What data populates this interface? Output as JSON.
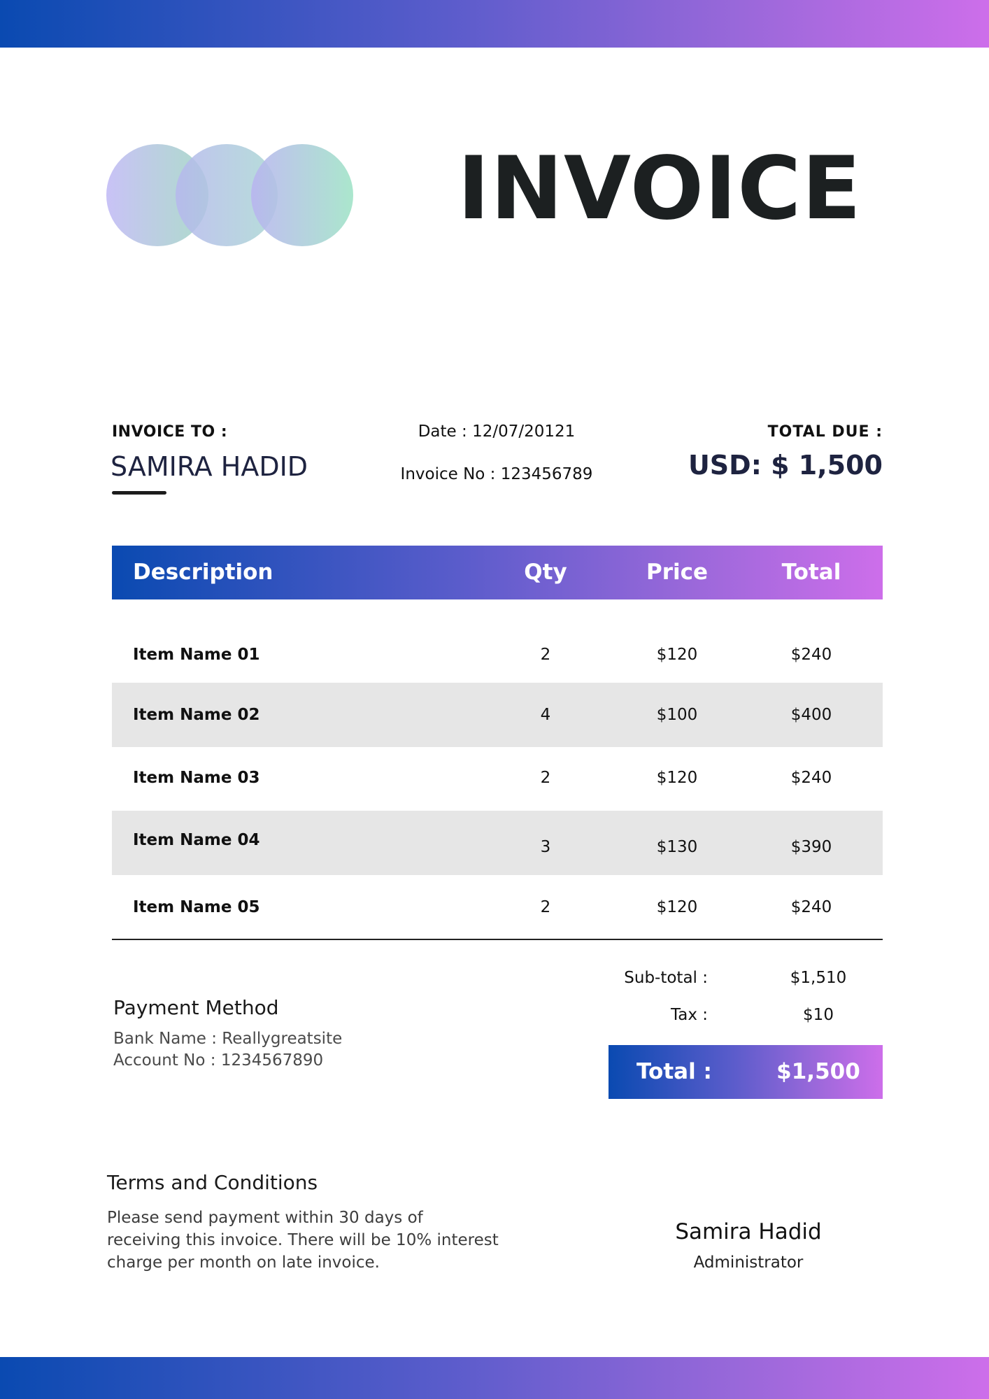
{
  "colors": {
    "gradient_start": "#0a4ab1",
    "gradient_end": "#cd6eea",
    "row_shade": "#e6e6e6",
    "title_text": "#1c2021",
    "client_text": "#1e2340"
  },
  "logo": {
    "icon": "three-overlapping-circles-logo"
  },
  "header": {
    "title": "INVOICE"
  },
  "bill_to": {
    "label": "INVOICE TO :",
    "name": "SAMIRA HADID"
  },
  "meta": {
    "date": "Date : 12/07/20121",
    "invoice_no": "Invoice No : 123456789"
  },
  "total_due": {
    "label": "TOTAL  DUE :",
    "amount": "USD: $ 1,500"
  },
  "table": {
    "columns": {
      "description": "Description",
      "qty": "Qty",
      "price": "Price",
      "total": "Total"
    },
    "rows": [
      {
        "description": "Item Name 01",
        "qty": "2",
        "price": "$120",
        "total": "$240"
      },
      {
        "description": "Item Name 02",
        "qty": "4",
        "price": "$100",
        "total": "$400"
      },
      {
        "description": "Item Name 03",
        "qty": "2",
        "price": "$120",
        "total": "$240"
      },
      {
        "description": "Item Name 04",
        "qty": "3",
        "price": "$130",
        "total": "$390"
      },
      {
        "description": "Item Name 05",
        "qty": "2",
        "price": "$120",
        "total": "$240"
      }
    ]
  },
  "payment": {
    "title": "Payment Method",
    "bank": "Bank Name : Reallygreatsite",
    "account": "Account No : 1234567890"
  },
  "summary": {
    "subtotal_label": "Sub-total :",
    "subtotal_value": "$1,510",
    "tax_label": "Tax :",
    "tax_value": "$10",
    "total_label": "Total :",
    "total_value": "$1,500"
  },
  "terms": {
    "title": "Terms  and Conditions",
    "line1": "Please send payment within 30 days of",
    "line2": "receiving this invoice. There will be 10% interest",
    "line3": "charge per month on late invoice."
  },
  "signature": {
    "name": "Samira Hadid",
    "role": "Administrator"
  }
}
